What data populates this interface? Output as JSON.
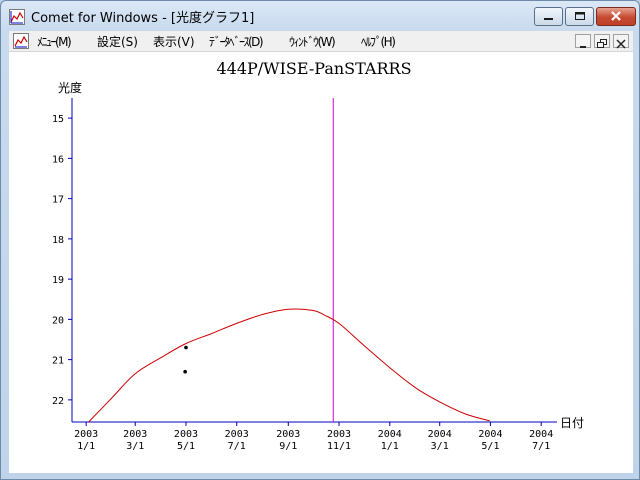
{
  "window": {
    "title": "Comet for Windows - [光度グラフ1]"
  },
  "menu": {
    "items": [
      "ﾒﾆｭｰ(M)",
      "設定(S)",
      "表示(V)",
      "ﾃﾞｰﾀﾍﾞｰｽ(D)",
      "ｳｨﾝﾄﾞｳ(W)",
      "ﾍﾙﾌﾟ(H)"
    ]
  },
  "icons": {
    "app": "chart-icon",
    "minimize": "minimize-icon",
    "maximize": "maximize-icon",
    "close": "close-icon",
    "mdi_minimize": "minimize-icon",
    "mdi_restore": "restore-icon",
    "mdi_close": "close-icon"
  },
  "colors": {
    "axis": "#0000c0",
    "curve": "#cc0000",
    "marker": "#cc00cc",
    "observation": "#000000"
  },
  "chart_data": {
    "type": "line",
    "title": "444P/WISE-PanSTARRS",
    "ylabel": "光度",
    "xlabel": "日付",
    "y_inverted": true,
    "ylim": [
      15,
      22.5
    ],
    "y_ticks": [
      15,
      16,
      17,
      18,
      19,
      20,
      21,
      22
    ],
    "x_start": "2002-12-15",
    "x_end": "2004-07-20",
    "x_ticks": [
      {
        "date": "2003-01-01",
        "year": "2003",
        "md": "1/1"
      },
      {
        "date": "2003-03-01",
        "year": "2003",
        "md": "3/1"
      },
      {
        "date": "2003-05-01",
        "year": "2003",
        "md": "5/1"
      },
      {
        "date": "2003-07-01",
        "year": "2003",
        "md": "7/1"
      },
      {
        "date": "2003-09-01",
        "year": "2003",
        "md": "9/1"
      },
      {
        "date": "2003-11-01",
        "year": "2003",
        "md": "11/1"
      },
      {
        "date": "2004-01-01",
        "year": "2004",
        "md": "1/1"
      },
      {
        "date": "2004-03-01",
        "year": "2004",
        "md": "3/1"
      },
      {
        "date": "2004-05-01",
        "year": "2004",
        "md": "5/1"
      },
      {
        "date": "2004-07-01",
        "year": "2004",
        "md": "7/1"
      }
    ],
    "series": [
      {
        "points": [
          [
            "2003-01-04",
            22.55
          ],
          [
            "2003-02-01",
            21.95
          ],
          [
            "2003-03-01",
            21.35
          ],
          [
            "2003-04-01",
            20.95
          ],
          [
            "2003-05-01",
            20.6
          ],
          [
            "2003-06-01",
            20.35
          ],
          [
            "2003-07-01",
            20.1
          ],
          [
            "2003-08-01",
            19.88
          ],
          [
            "2003-09-01",
            19.75
          ],
          [
            "2003-10-01",
            19.78
          ],
          [
            "2003-10-15",
            19.9
          ],
          [
            "2003-11-01",
            20.1
          ],
          [
            "2003-12-01",
            20.65
          ],
          [
            "2004-01-01",
            21.2
          ],
          [
            "2004-02-01",
            21.7
          ],
          [
            "2004-03-01",
            22.05
          ],
          [
            "2004-04-01",
            22.35
          ],
          [
            "2004-04-30",
            22.52
          ]
        ]
      }
    ],
    "observations": [
      [
        "2003-05-01",
        20.7
      ],
      [
        "2003-04-30",
        21.3
      ]
    ],
    "current_date_marker": "2003-10-25",
    "grid": false
  }
}
